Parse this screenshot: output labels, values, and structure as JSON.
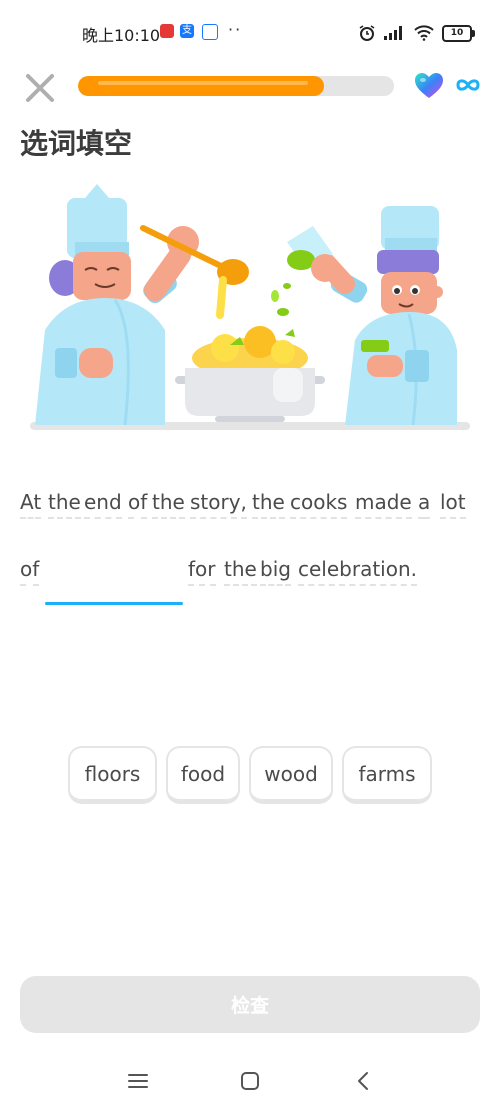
{
  "status_bar": {
    "time": "晚上10:10",
    "battery": "10",
    "icons": [
      "app-notification-icon",
      "alipay-icon",
      "app-icon",
      "more-dots",
      "alarm-icon",
      "signal-icon",
      "wifi-icon",
      "battery-icon"
    ]
  },
  "header": {
    "progress": 0.78,
    "progress_color": "#ff9600",
    "hearts": "infinity"
  },
  "exercise": {
    "title": "选词填空",
    "line1": [
      "At",
      "the",
      "end",
      "of",
      "the",
      "story,",
      "the",
      "cooks",
      "made",
      "a",
      "lot"
    ],
    "line2_before": "of",
    "line2_after": [
      "for",
      "the",
      "big",
      "celebration."
    ]
  },
  "word_bank": [
    "floors",
    "food",
    "wood",
    "farms"
  ],
  "check_label": "检查",
  "colors": {
    "accent_blue": "#1cb0f6",
    "disabled_gray": "#e5e5e5",
    "orange": "#ff9600"
  }
}
